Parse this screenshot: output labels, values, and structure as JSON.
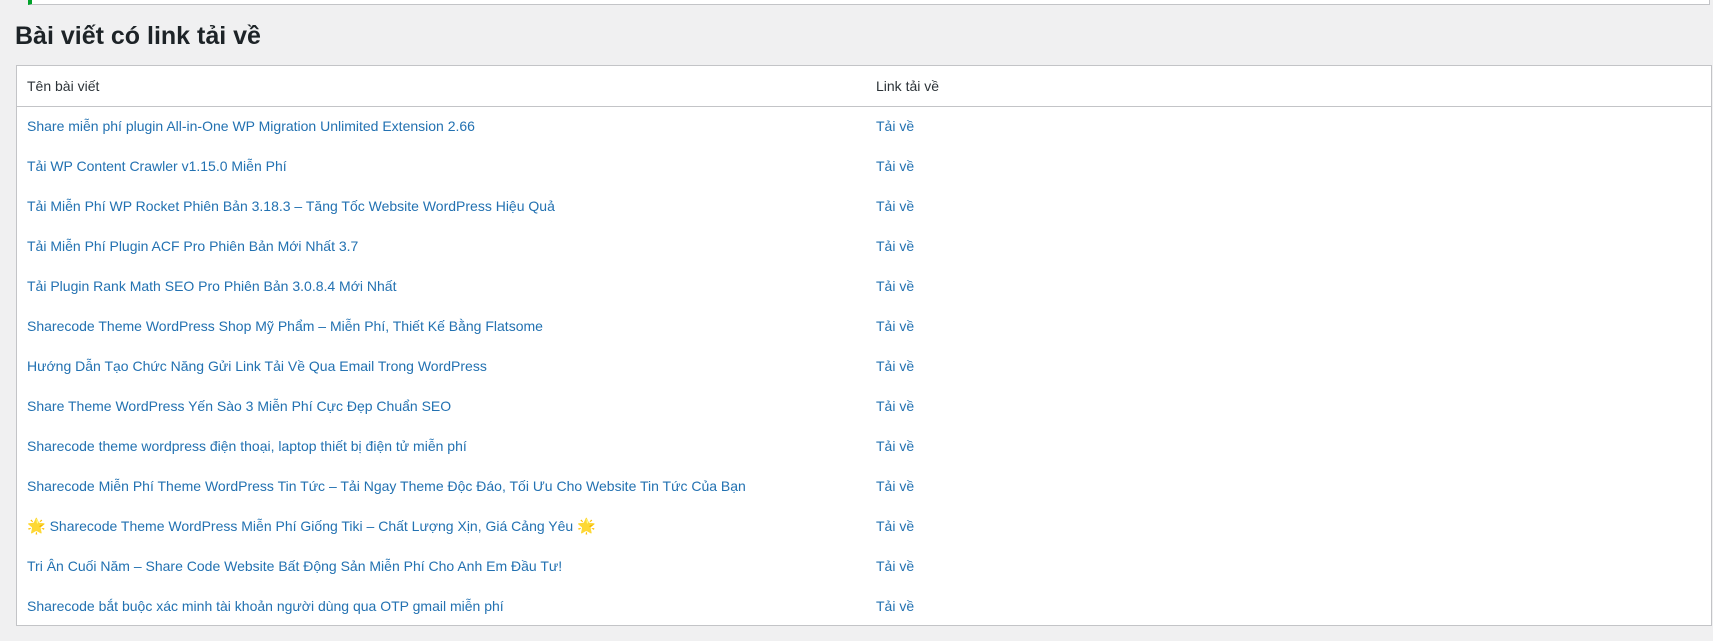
{
  "page": {
    "title": "Bài viết có link tải về"
  },
  "table": {
    "columns": [
      "Tên bài viết",
      "Link tải về"
    ],
    "download_label": "Tải về",
    "rows": [
      {
        "title": "Share miễn phí plugin All-in-One WP Migration Unlimited Extension 2.66",
        "link": "Tải về"
      },
      {
        "title": "Tải WP Content Crawler v1.15.0 Miễn Phí",
        "link": "Tải về"
      },
      {
        "title": "Tải Miễn Phí WP Rocket Phiên Bản 3.18.3 – Tăng Tốc Website WordPress Hiệu Quả",
        "link": "Tải về"
      },
      {
        "title": "Tải Miễn Phí Plugin ACF Pro Phiên Bản Mới Nhất 3.7",
        "link": "Tải về"
      },
      {
        "title": "Tải Plugin Rank Math SEO Pro Phiên Bản 3.0.8.4 Mới Nhất",
        "link": "Tải về"
      },
      {
        "title": "Sharecode Theme WordPress Shop Mỹ Phẩm – Miễn Phí, Thiết Kế Bằng Flatsome",
        "link": "Tải về"
      },
      {
        "title": "Hướng Dẫn Tạo Chức Năng Gửi Link Tải Về Qua Email Trong WordPress",
        "link": "Tải về"
      },
      {
        "title": "Share Theme WordPress Yến Sào 3 Miễn Phí Cực Đẹp Chuẩn SEO",
        "link": "Tải về"
      },
      {
        "title": "Sharecode theme wordpress điện thoại, laptop thiết bị điện tử miễn phí",
        "link": "Tải về"
      },
      {
        "title": "Sharecode Miễn Phí Theme WordPress Tin Tức – Tải Ngay Theme Độc Đáo, Tối Ưu Cho Website Tin Tức Của Bạn",
        "link": "Tải về"
      },
      {
        "title": "Sharecode Theme WordPress Miễn Phí Giống Tiki – Chất Lượng Xịn, Giá Cảng Yêu",
        "link": "Tải về",
        "star": "🌟"
      },
      {
        "title": "Tri Ân Cuối Năm – Share Code Website Bất Động Sản Miễn Phí Cho Anh Em Đầu Tư!",
        "link": "Tải về"
      },
      {
        "title": "Sharecode bắt buộc xác minh tài khoản người dùng qua OTP gmail miễn phí",
        "link": "Tải về"
      }
    ]
  },
  "colors": {
    "link": "#2271b1",
    "notice_accent": "#00a32a",
    "background": "#f0f0f1"
  }
}
